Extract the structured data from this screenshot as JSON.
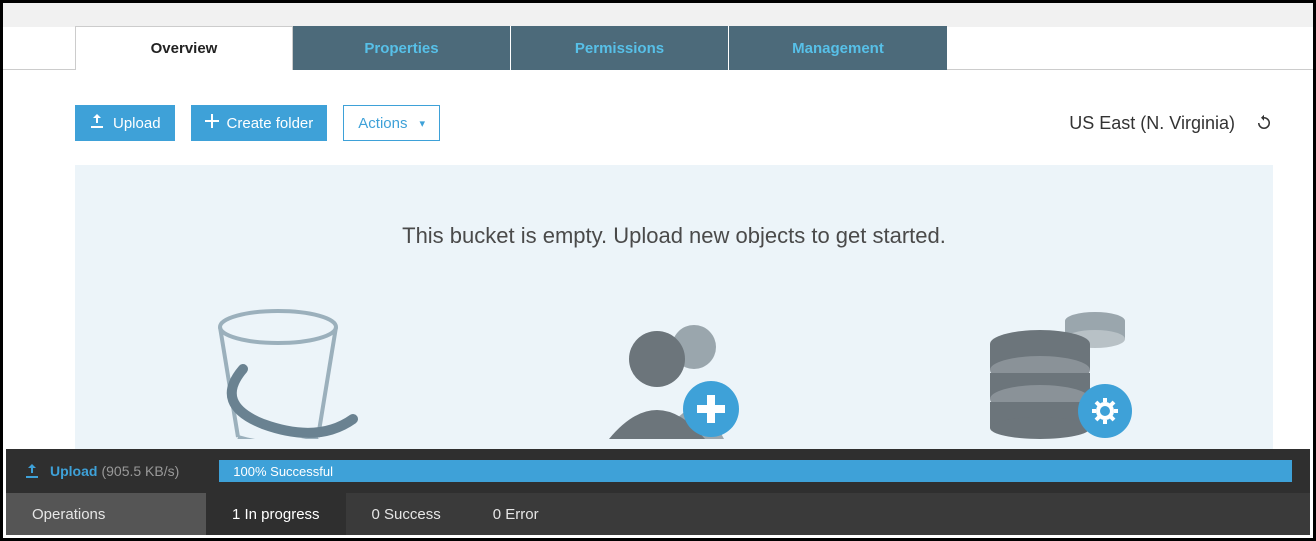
{
  "tabs": [
    {
      "label": "Overview",
      "active": true
    },
    {
      "label": "Properties",
      "active": false
    },
    {
      "label": "Permissions",
      "active": false
    },
    {
      "label": "Management",
      "active": false
    }
  ],
  "toolbar": {
    "upload_label": "Upload",
    "create_folder_label": "Create folder",
    "actions_label": "Actions"
  },
  "region": "US East (N. Virginia)",
  "empty_message": "This bucket is empty. Upload new objects to get started.",
  "upload_status": {
    "label": "Upload",
    "speed": "(905.5 KB/s)",
    "progress_text": "100% Successful"
  },
  "footer_tabs": {
    "operations": "Operations",
    "in_progress": "1 In progress",
    "success": "0 Success",
    "error": "0 Error"
  },
  "colors": {
    "accent": "#3ea1d8",
    "tab_bg": "#4c6a7a",
    "tab_text": "#57c0e8"
  }
}
